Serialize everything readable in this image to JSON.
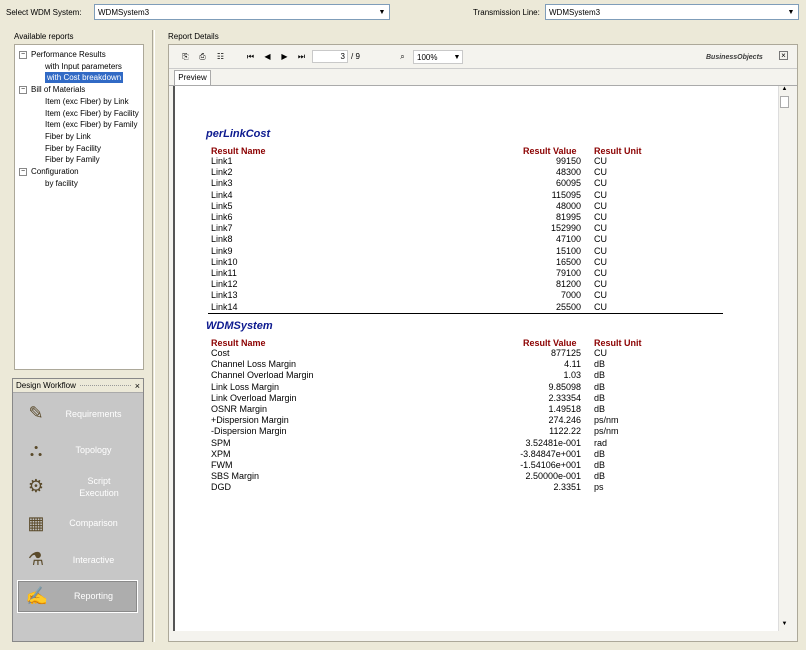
{
  "top": {
    "wdm_label": "Select WDM System:",
    "wdm_value": "WDMSystem3",
    "tl_label": "Transmission Line:",
    "tl_value": "WDMSystem3"
  },
  "left": {
    "available_title": "Available reports",
    "tree": [
      {
        "label": "Performance Results",
        "level": 0
      },
      {
        "label": "with Input parameters",
        "level": 1
      },
      {
        "label": "with Cost breakdown",
        "level": 1,
        "selected": true
      },
      {
        "label": "Bill of Materials",
        "level": 0
      },
      {
        "label": "Item (exc Fiber) by Link",
        "level": 1
      },
      {
        "label": "Item (exc Fiber) by Facility",
        "level": 1
      },
      {
        "label": "Item (exc Fiber) by Family",
        "level": 1
      },
      {
        "label": "Fiber by Link",
        "level": 1
      },
      {
        "label": "Fiber by Facility",
        "level": 1
      },
      {
        "label": "Fiber by Family",
        "level": 1
      },
      {
        "label": "Configuration",
        "level": 0
      },
      {
        "label": "by facility",
        "level": 1
      }
    ]
  },
  "workflow": {
    "title": "Design Workflow",
    "close": "×",
    "items": [
      {
        "label": "Requirements",
        "icon": "requirements-icon"
      },
      {
        "label": "Topology",
        "icon": "topology-icon"
      },
      {
        "label": "Script Execution",
        "icon": "script-execution-icon"
      },
      {
        "label": "Comparison",
        "icon": "comparison-icon"
      },
      {
        "label": "Interactive",
        "icon": "interactive-icon"
      },
      {
        "label": "Reporting",
        "icon": "reporting-icon"
      }
    ]
  },
  "report": {
    "title": "Report Details",
    "page_current": "3",
    "page_total": "/ 9",
    "zoom": "100%",
    "brand": "BusinessObjects",
    "close": "×",
    "tab": "Preview",
    "perlink": {
      "title": "perLinkCost",
      "headers": [
        "Result Name",
        "Result Value",
        "Result Unit"
      ],
      "rows": [
        [
          "Link1",
          "99150",
          "CU"
        ],
        [
          "Link2",
          "48300",
          "CU"
        ],
        [
          "Link3",
          "60095",
          "CU"
        ],
        [
          "Link4",
          "115095",
          "CU"
        ],
        [
          "Link5",
          "48000",
          "CU"
        ],
        [
          "Link6",
          "81995",
          "CU"
        ],
        [
          "Link7",
          "152990",
          "CU"
        ],
        [
          "Link8",
          "47100",
          "CU"
        ],
        [
          "Link9",
          "15100",
          "CU"
        ],
        [
          "Link10",
          "16500",
          "CU"
        ],
        [
          "Link11",
          "79100",
          "CU"
        ],
        [
          "Link12",
          "81200",
          "CU"
        ],
        [
          "Link13",
          "7000",
          "CU"
        ],
        [
          "Link14",
          "25500",
          "CU"
        ]
      ]
    },
    "wdm": {
      "title": "WDMSystem",
      "headers": [
        "Result Name",
        "Result Value",
        "Result Unit"
      ],
      "rows": [
        [
          "Cost",
          "877125",
          "CU"
        ],
        [
          "Channel Loss Margin",
          "4.11",
          "dB"
        ],
        [
          "Channel Overload Margin",
          "1.03",
          "dB"
        ],
        [
          "Link Loss Margin",
          "9.85098",
          "dB"
        ],
        [
          "Link Overload Margin",
          "2.33354",
          "dB"
        ],
        [
          "OSNR Margin",
          "1.49518",
          "dB"
        ],
        [
          "+Dispersion Margin",
          "274.246",
          "ps/nm"
        ],
        [
          "-Dispersion Margin",
          "1122.22",
          "ps/nm"
        ],
        [
          "SPM",
          "3.52481e-001",
          "rad"
        ],
        [
          "XPM",
          "-3.84847e+001",
          "dB"
        ],
        [
          "FWM",
          "-1.54106e+001",
          "dB"
        ],
        [
          "SBS Margin",
          "2.50000e-001",
          "dB"
        ],
        [
          "DGD",
          "2.3351",
          "ps"
        ]
      ]
    }
  }
}
